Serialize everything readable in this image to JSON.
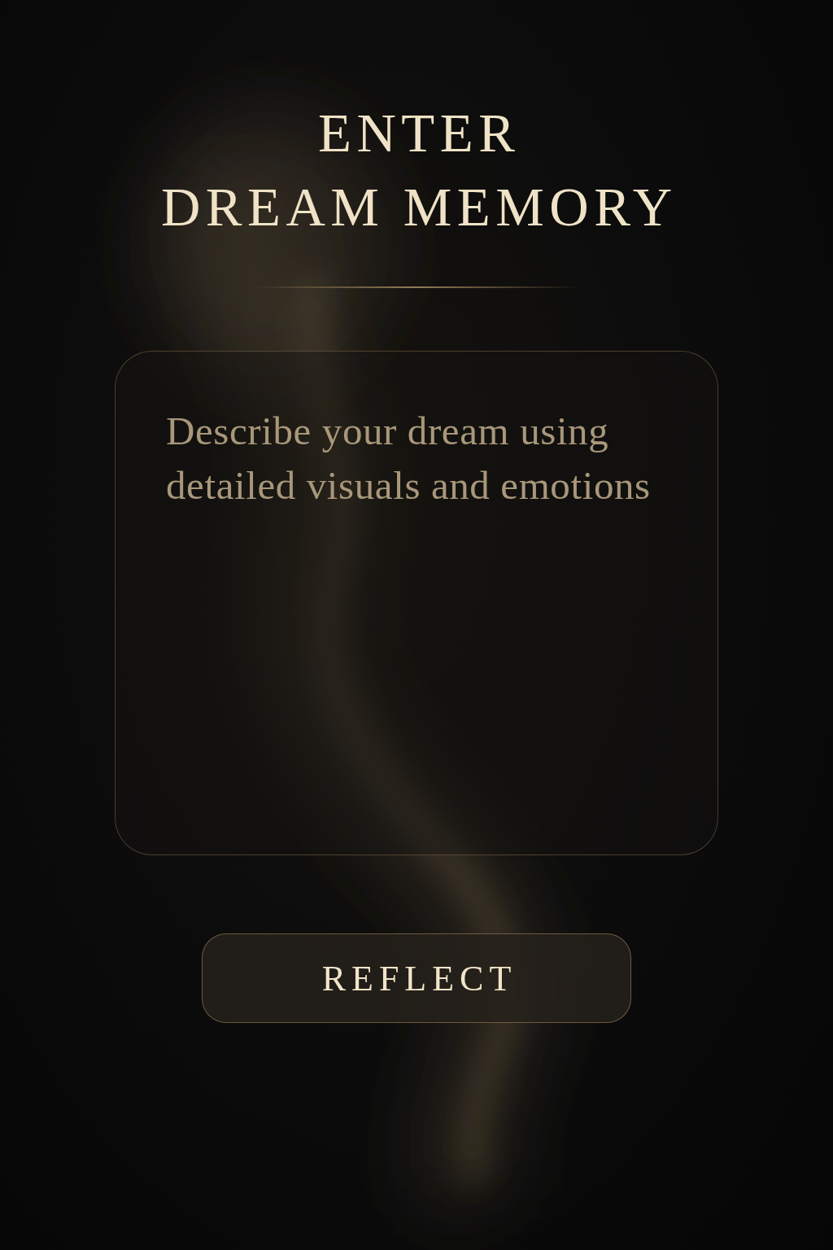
{
  "title": [
    "ENTER",
    "DREAM MEMORY"
  ],
  "dream_input": {
    "placeholder": "Describe your dream using detailed visuals and emotions"
  },
  "buttons": [
    {
      "label": "REFLECT"
    }
  ]
}
